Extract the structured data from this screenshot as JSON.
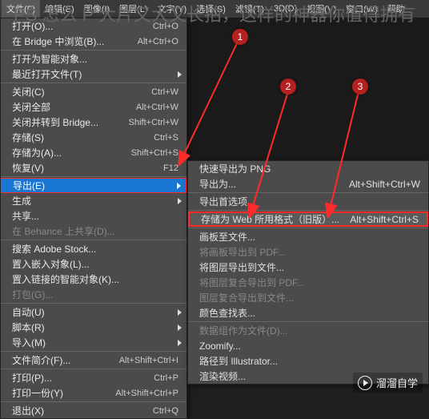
{
  "overlay_title": "PS 怎么 P 大片又大又长拍，这样的神器你值得拥有",
  "markers": {
    "m1": "1",
    "m2": "2",
    "m3": "3"
  },
  "watermark": "溜溜自学",
  "menubar": [
    "文件(F)",
    "编辑(E)",
    "图像(I)",
    "图层(L)",
    "文字(Y)",
    "选择(S)",
    "滤镜(T)",
    "3D(D)",
    "视图(V)",
    "窗口(W)",
    "帮助"
  ],
  "file_menu": [
    {
      "type": "item",
      "label": "打开(O)...",
      "shortcut": "Ctrl+O"
    },
    {
      "type": "item",
      "label": "在 Bridge 中浏览(B)...",
      "shortcut": "Alt+Ctrl+O"
    },
    {
      "type": "sep"
    },
    {
      "type": "item",
      "label": "打开为智能对象..."
    },
    {
      "type": "item",
      "label": "最近打开文件(T)",
      "sub": true
    },
    {
      "type": "sep"
    },
    {
      "type": "item",
      "label": "关闭(C)",
      "shortcut": "Ctrl+W"
    },
    {
      "type": "item",
      "label": "关闭全部",
      "shortcut": "Alt+Ctrl+W"
    },
    {
      "type": "item",
      "label": "关闭并转到 Bridge...",
      "shortcut": "Shift+Ctrl+W"
    },
    {
      "type": "item",
      "label": "存储(S)",
      "shortcut": "Ctrl+S"
    },
    {
      "type": "item",
      "label": "存储为(A)...",
      "shortcut": "Shift+Ctrl+S"
    },
    {
      "type": "item",
      "label": "恢复(V)",
      "shortcut": "F12"
    },
    {
      "type": "sep"
    },
    {
      "type": "item",
      "label": "导出(E)",
      "sub": true,
      "hl": true
    },
    {
      "type": "item",
      "label": "生成",
      "sub": true
    },
    {
      "type": "item",
      "label": "共享..."
    },
    {
      "type": "item",
      "label": "在 Behance 上共享(D)...",
      "disabled": true
    },
    {
      "type": "sep"
    },
    {
      "type": "item",
      "label": "搜索 Adobe Stock..."
    },
    {
      "type": "item",
      "label": "置入嵌入对象(L)..."
    },
    {
      "type": "item",
      "label": "置入链接的智能对象(K)..."
    },
    {
      "type": "item",
      "label": "打包(G)...",
      "disabled": true
    },
    {
      "type": "sep"
    },
    {
      "type": "item",
      "label": "自动(U)",
      "sub": true
    },
    {
      "type": "item",
      "label": "脚本(R)",
      "sub": true
    },
    {
      "type": "item",
      "label": "导入(M)",
      "sub": true
    },
    {
      "type": "sep"
    },
    {
      "type": "item",
      "label": "文件简介(F)...",
      "shortcut": "Alt+Shift+Ctrl+I"
    },
    {
      "type": "sep"
    },
    {
      "type": "item",
      "label": "打印(P)...",
      "shortcut": "Ctrl+P"
    },
    {
      "type": "item",
      "label": "打印一份(Y)",
      "shortcut": "Alt+Shift+Ctrl+P"
    },
    {
      "type": "sep"
    },
    {
      "type": "item",
      "label": "退出(X)",
      "shortcut": "Ctrl+Q"
    }
  ],
  "export_submenu": [
    {
      "type": "item",
      "label": "快速导出为 PNG"
    },
    {
      "type": "item",
      "label": "导出为...",
      "shortcut": "Alt+Shift+Ctrl+W"
    },
    {
      "type": "sep"
    },
    {
      "type": "item",
      "label": "导出首选项..."
    },
    {
      "type": "sep"
    },
    {
      "type": "item",
      "label": "存储为 Web 所用格式（旧版）...",
      "shortcut": "Alt+Shift+Ctrl+S",
      "hl": true
    },
    {
      "type": "sep"
    },
    {
      "type": "item",
      "label": "画板至文件..."
    },
    {
      "type": "item",
      "label": "将画板导出到 PDF...",
      "disabled": true
    },
    {
      "type": "item",
      "label": "将图层导出到文件..."
    },
    {
      "type": "item",
      "label": "将图层复合导出到 PDF...",
      "disabled": true
    },
    {
      "type": "item",
      "label": "图层复合导出到文件...",
      "disabled": true
    },
    {
      "type": "item",
      "label": "颜色查找表..."
    },
    {
      "type": "sep"
    },
    {
      "type": "item",
      "label": "数据组作为文件(D)...",
      "disabled": true
    },
    {
      "type": "item",
      "label": "Zoomify..."
    },
    {
      "type": "item",
      "label": "路径到 Illustrator..."
    },
    {
      "type": "item",
      "label": "渲染视频..."
    }
  ]
}
